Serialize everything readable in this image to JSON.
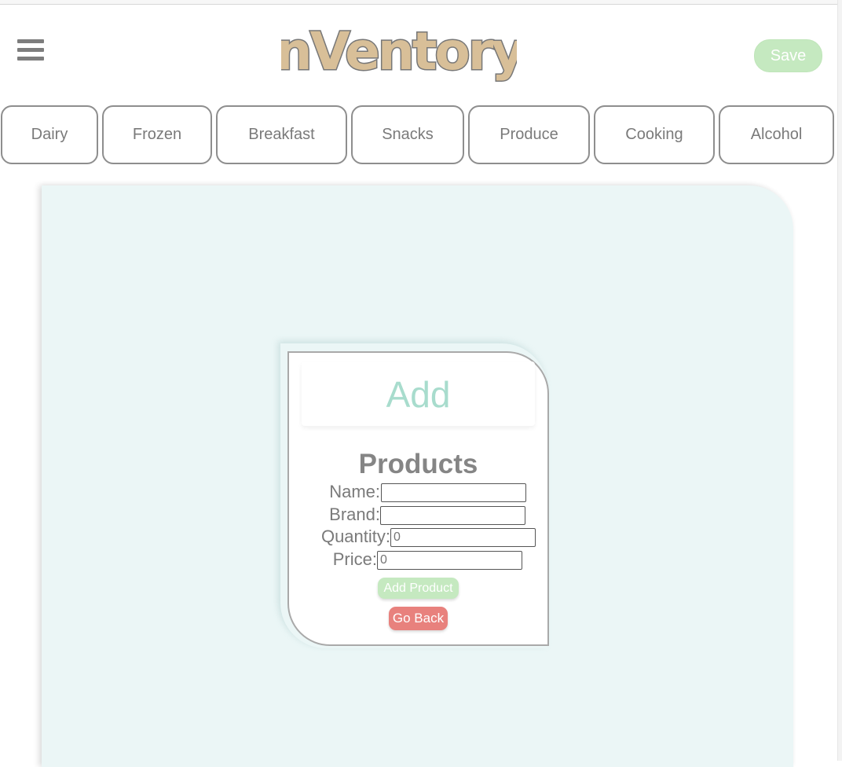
{
  "header": {
    "logo_text": "nVentory",
    "save_label": "Save",
    "menu_icon": "hamburger-menu-icon"
  },
  "categories": [
    {
      "label": "Dairy"
    },
    {
      "label": "Frozen"
    },
    {
      "label": "Breakfast"
    },
    {
      "label": "Snacks"
    },
    {
      "label": "Produce"
    },
    {
      "label": "Cooking"
    },
    {
      "label": "Alcohol"
    }
  ],
  "form": {
    "title": "Add",
    "heading": "Products",
    "fields": {
      "name": {
        "label": "Name:",
        "value": ""
      },
      "brand": {
        "label": "Brand:",
        "value": ""
      },
      "quantity": {
        "label": "Quantity:",
        "placeholder": "0"
      },
      "price": {
        "label": "Price:",
        "placeholder": "0"
      }
    },
    "add_button": "Add Product",
    "back_button": "Go Back"
  },
  "colors": {
    "accent_green": "#c5e9c0",
    "title_teal": "#a8dccd",
    "danger_red": "#e8817d",
    "panel_bg": "#ebf6f6",
    "logo_fill": "#d8bf98"
  }
}
